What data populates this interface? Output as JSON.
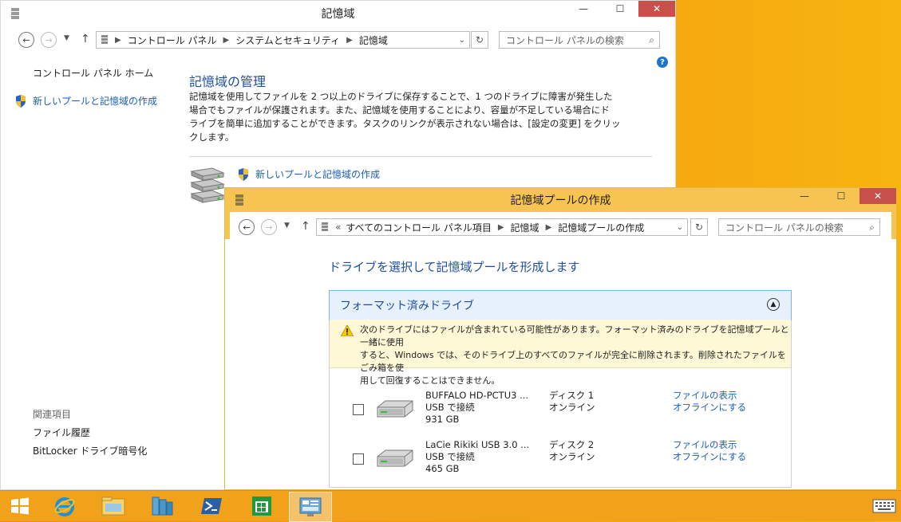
{
  "win1": {
    "title": "記憶域",
    "controls": {
      "minimize": "—",
      "maximize": "☐",
      "close": "✕"
    },
    "breadcrumb": [
      "コントロール パネル",
      "システムとセキュリティ",
      "記憶域"
    ],
    "search_placeholder": "コントロール パネルの検索",
    "help_glyph": "?",
    "sidebar": {
      "home": "コントロール パネル ホーム",
      "new_pool": "新しいプールと記憶域の作成",
      "related_title": "関連項目",
      "related": [
        "ファイル履歴",
        "BitLocker ドライブ暗号化"
      ]
    },
    "main": {
      "heading": "記憶域の管理",
      "description_lines": [
        "記憶域を使用してファイルを 2 つ以上のドライブに保存することで、1 つのドライブに障害が発生した",
        "場合でもファイルが保護されます。また、記憶域を使用することにより、容量が不足している場合にド",
        "ライブを簡単に追加することができます。タスクのリンクが表示されない場合は、[設定の変更] をクリッ",
        "クします。"
      ],
      "new_pool_link": "新しいプールと記憶域の作成"
    }
  },
  "win2": {
    "title": "記憶域プールの作成",
    "controls": {
      "minimize": "—",
      "maximize": "☐",
      "close": "✕"
    },
    "breadcrumb_prefix": "«",
    "breadcrumb": [
      "すべてのコントロール パネル項目",
      "記憶域",
      "記憶域プールの作成"
    ],
    "search_placeholder": "コントロール パネルの検索",
    "heading": "ドライブを選択して記憶域プールを形成します",
    "section_title": "フォーマット済みドライブ",
    "warning_lines": [
      "次のドライブにはファイルが含まれている可能性があります。フォーマット済みのドライブを記憶域プールと一緒に使用",
      "すると、Windows では、そのドライブ上のすべてのファイルが完全に削除されます。削除されたファイルをごみ箱を使",
      "用して回復することはできません。"
    ],
    "drives": [
      {
        "name": "BUFFALO HD-PCTU3 ...",
        "connection": "USB で接続",
        "size": "931 GB",
        "disk": "ディスク 1",
        "status": "オンライン",
        "link_view": "ファイルの表示",
        "link_offline": "オフラインにする"
      },
      {
        "name": "LaCie Rikiki USB 3.0 ...",
        "connection": "USB で接続",
        "size": "465 GB",
        "disk": "ディスク 2",
        "status": "オンライン",
        "link_view": "ファイルの表示",
        "link_offline": "オフラインにする"
      }
    ]
  },
  "taskbar": {
    "icons": [
      "windows-start-icon",
      "internet-explorer-icon",
      "file-explorer-icon",
      "server-manager-icon",
      "powershell-icon",
      "store-icon",
      "control-panel-icon",
      "touch-keyboard-icon"
    ]
  },
  "colors": {
    "link": "#1a5fb4",
    "heading": "#1e4f9b",
    "accent_title": "#f7c451",
    "close": "#c7504b",
    "warning_bg": "#fef8d6"
  }
}
